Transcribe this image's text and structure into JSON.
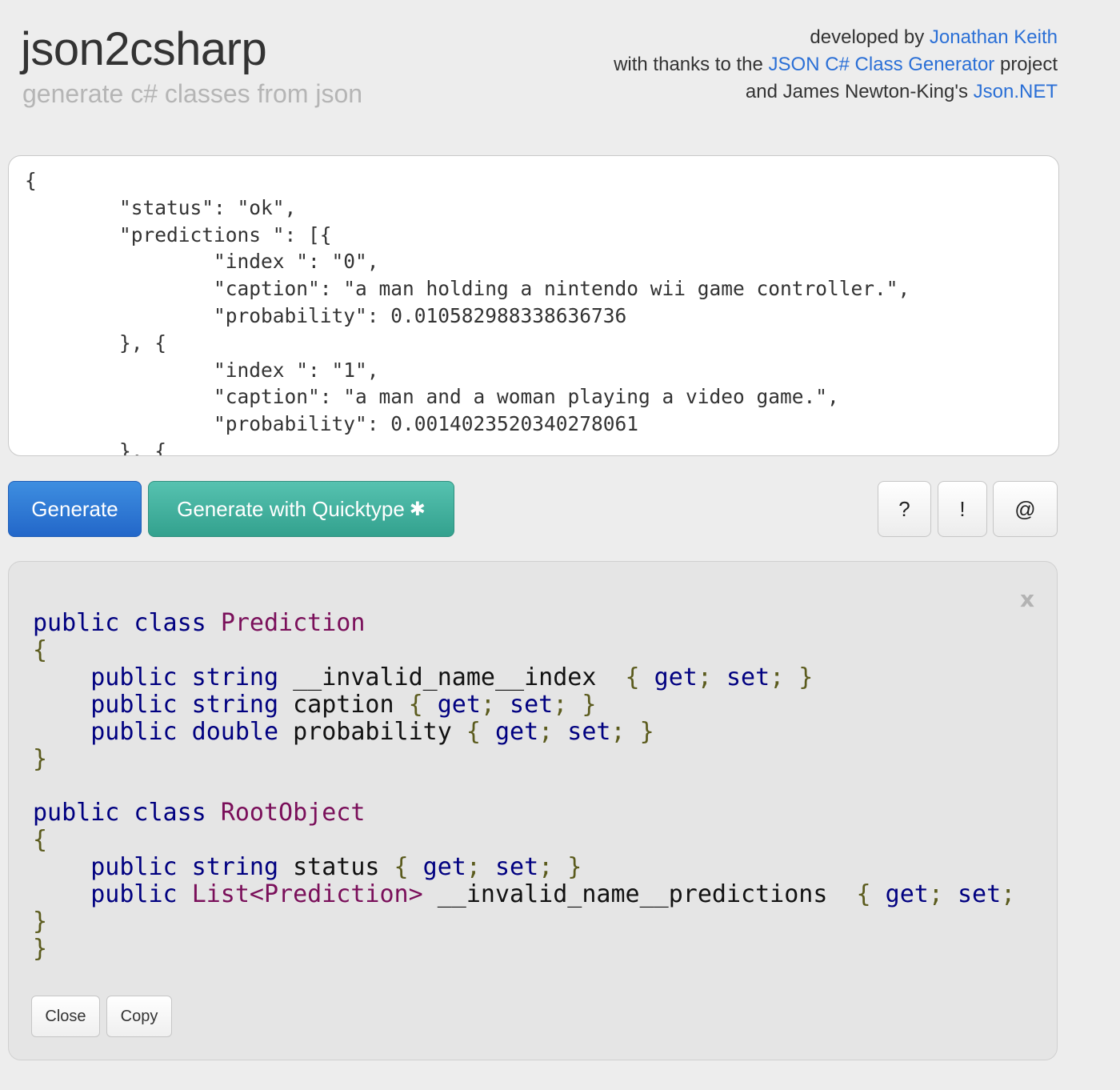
{
  "header": {
    "title": "json2csharp",
    "subtitle": "generate c# classes from json",
    "credits": {
      "line1_prefix": "developed by ",
      "line1_link": "Jonathan Keith",
      "line2_prefix": "with thanks to the ",
      "line2_link": "JSON C# Class Generator",
      "line2_suffix": " project",
      "line3_prefix": "and James Newton-King's ",
      "line3_link": "Json.NET"
    }
  },
  "input": {
    "json_text": "{\n\t\"status\": \"ok\",\n\t\"predictions \": [{\n\t\t\"index \": \"0\",\n\t\t\"caption\": \"a man holding a nintendo wii game controller.\",\n\t\t\"probability\": 0.010582988338636736\n\t}, {\n\t\t\"index \": \"1\",\n\t\t\"caption\": \"a man and a woman playing a video game.\",\n\t\t\"probability\": 0.0014023520340278061\n\t}, {"
  },
  "toolbar": {
    "generate_label": "Generate",
    "quicktype_label": "Generate with Quicktype",
    "quicktype_icon": "asterisk-icon",
    "help_label": "?",
    "bang_label": "!",
    "at_label": "@"
  },
  "output": {
    "close_x_label": "x",
    "code": [
      [
        [
          "kw",
          "public class "
        ],
        [
          "ty",
          "Prediction"
        ]
      ],
      [
        [
          "pn",
          "{"
        ]
      ],
      [
        [
          "kw",
          "    public string "
        ],
        [
          "id",
          "__invalid_name__index  "
        ],
        [
          "pn",
          "{ "
        ],
        [
          "kw",
          "get"
        ],
        [
          "pn",
          "; "
        ],
        [
          "kw",
          "set"
        ],
        [
          "pn",
          "; }"
        ]
      ],
      [
        [
          "kw",
          "    public string "
        ],
        [
          "id",
          "caption "
        ],
        [
          "pn",
          "{ "
        ],
        [
          "kw",
          "get"
        ],
        [
          "pn",
          "; "
        ],
        [
          "kw",
          "set"
        ],
        [
          "pn",
          "; }"
        ]
      ],
      [
        [
          "kw",
          "    public double "
        ],
        [
          "id",
          "probability "
        ],
        [
          "pn",
          "{ "
        ],
        [
          "kw",
          "get"
        ],
        [
          "pn",
          "; "
        ],
        [
          "kw",
          "set"
        ],
        [
          "pn",
          "; }"
        ]
      ],
      [
        [
          "pn",
          "}"
        ]
      ],
      [
        [
          "id",
          ""
        ]
      ],
      [
        [
          "kw",
          "public class "
        ],
        [
          "ty",
          "RootObject"
        ]
      ],
      [
        [
          "pn",
          "{"
        ]
      ],
      [
        [
          "kw",
          "    public string "
        ],
        [
          "id",
          "status "
        ],
        [
          "pn",
          "{ "
        ],
        [
          "kw",
          "get"
        ],
        [
          "pn",
          "; "
        ],
        [
          "kw",
          "set"
        ],
        [
          "pn",
          "; }"
        ]
      ],
      [
        [
          "kw",
          "    public "
        ],
        [
          "ty",
          "List<Prediction>"
        ],
        [
          "id",
          " __invalid_name__predictions  "
        ],
        [
          "pn",
          "{ "
        ],
        [
          "kw",
          "get"
        ],
        [
          "pn",
          "; "
        ],
        [
          "kw",
          "set"
        ],
        [
          "pn",
          ";"
        ]
      ],
      [
        [
          "pn",
          "}"
        ]
      ],
      [
        [
          "pn",
          "}"
        ]
      ]
    ],
    "close_label": "Close",
    "copy_label": "Copy"
  },
  "colors": {
    "primary": "#2a77d6",
    "teal": "#43b19f",
    "link": "#2a6fd6",
    "keyword": "#000080",
    "type": "#7a0f5a",
    "punct": "#5b5b1d"
  }
}
